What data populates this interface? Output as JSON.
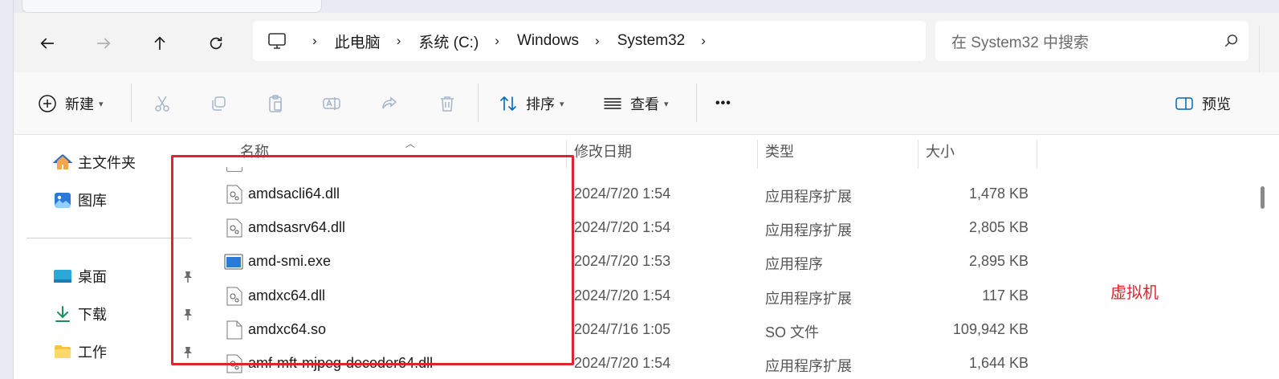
{
  "address_bar": {
    "crumbs": [
      "此电脑",
      "系统 (C:)",
      "Windows",
      "System32"
    ],
    "search_placeholder": "在 System32 中搜索"
  },
  "toolbar": {
    "new_label": "新建",
    "sort_label": "排序",
    "view_label": "查看",
    "more_label": "•••",
    "preview_label": "预览"
  },
  "sidebar": {
    "items": [
      {
        "label": "主文件夹",
        "icon": "home-icon"
      },
      {
        "label": "图库",
        "icon": "gallery-icon"
      },
      {
        "label": "桌面",
        "icon": "desktop-icon"
      },
      {
        "label": "下载",
        "icon": "download-icon"
      },
      {
        "label": "工作",
        "icon": "folder-icon"
      }
    ]
  },
  "columns": {
    "name": "名称",
    "modified": "修改日期",
    "type": "类型",
    "size": "大小"
  },
  "files": [
    {
      "name": "amdsacli64.dll",
      "modified": "2024/7/20 1:54",
      "type": "应用程序扩展",
      "size": "1,478 KB",
      "icon": "dll-file-icon"
    },
    {
      "name": "amdsasrv64.dll",
      "modified": "2024/7/20 1:54",
      "type": "应用程序扩展",
      "size": "2,805 KB",
      "icon": "dll-file-icon"
    },
    {
      "name": "amd-smi.exe",
      "modified": "2024/7/20 1:53",
      "type": "应用程序",
      "size": "2,895 KB",
      "icon": "exe-file-icon"
    },
    {
      "name": "amdxc64.dll",
      "modified": "2024/7/20 1:54",
      "type": "应用程序扩展",
      "size": "117 KB",
      "icon": "dll-file-icon"
    },
    {
      "name": "amdxc64.so",
      "modified": "2024/7/16 1:05",
      "type": "SO 文件",
      "size": "109,942 KB",
      "icon": "blank-file-icon"
    },
    {
      "name": "amf-mft-mjpeg-decoder64.dll",
      "modified": "2024/7/20 1:54",
      "type": "应用程序扩展",
      "size": "1,644 KB",
      "icon": "dll-file-icon"
    }
  ],
  "annotation": "虚拟机",
  "colors": {
    "highlight": "#e0242f",
    "accent": "#0067c0"
  }
}
